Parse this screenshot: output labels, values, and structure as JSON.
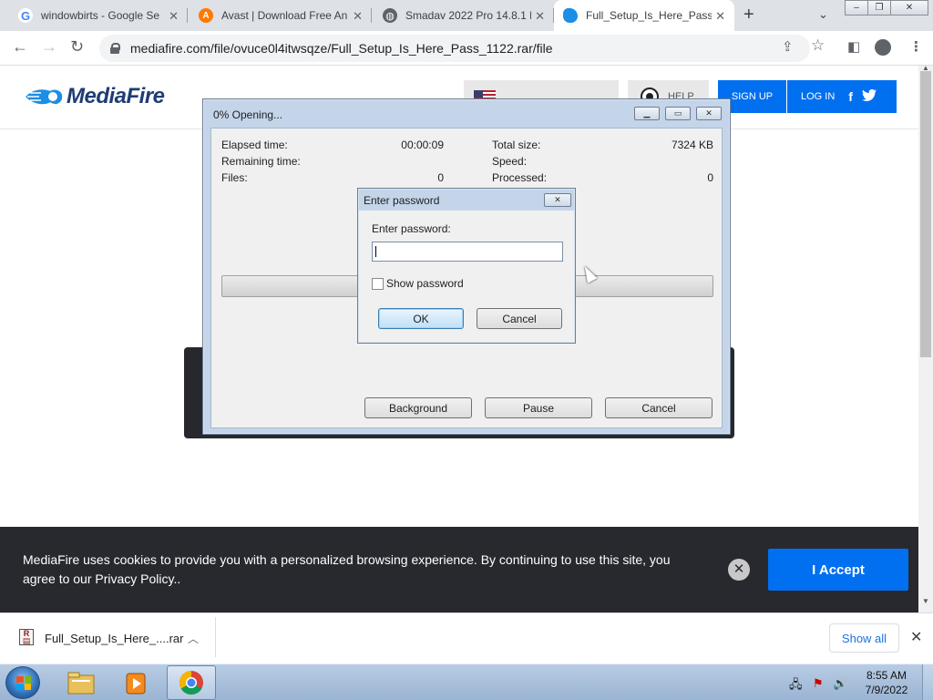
{
  "tabs": [
    {
      "title": "windowbirts - Google Se",
      "icon": "google-icon"
    },
    {
      "title": "Avast | Download Free An",
      "icon": "avast-icon"
    },
    {
      "title": "Smadav 2022 Pro 14.8.1 F",
      "icon": "globe-icon"
    },
    {
      "title": "Full_Setup_Is_Here_Pass_",
      "icon": "mediafire-icon",
      "active": true
    }
  ],
  "address": {
    "url": "mediafire.com/file/ovuce0l4itwsqze/Full_Setup_Is_Here_Pass_1122.rar/file"
  },
  "mediafire": {
    "logo_text": "MediaFire",
    "help_label": "HELP",
    "signup_label": "SIGN UP",
    "login_label": "LOG IN",
    "facebook_glyph": "f",
    "twitter_glyph": "🐦",
    "brand_color": "#0070f0"
  },
  "rar_dialog": {
    "title": "0% Opening...",
    "elapsed_label": "Elapsed time:",
    "elapsed_value": "00:00:09",
    "remaining_label": "Remaining time:",
    "files_label": "Files:",
    "files_value": "0",
    "total_size_label": "Total size:",
    "total_size_value": "7324 KB",
    "speed_label": "Speed:",
    "processed_label": "Processed:",
    "processed_value": "0",
    "background_label": "Background",
    "pause_label": "Pause",
    "cancel_label": "Cancel",
    "progress": 0
  },
  "password_dialog": {
    "title": "Enter password",
    "prompt": "Enter password:",
    "value": "",
    "show_password_label": "Show password",
    "show_password_checked": false,
    "ok_label": "OK",
    "cancel_label": "Cancel"
  },
  "cookie_banner": {
    "message": "MediaFire uses cookies to provide you with a personalized browsing experience. By continuing to use this site, you agree to our Privacy Policy..",
    "accept_label": "I Accept"
  },
  "download_shelf": {
    "filename": "Full_Setup_Is_Here_....rar",
    "show_all_label": "Show all"
  },
  "taskbar": {
    "time": "8:55 AM",
    "date": "7/9/2022"
  }
}
